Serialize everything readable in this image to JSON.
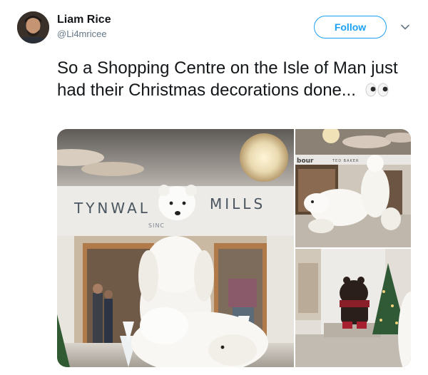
{
  "author": {
    "name": "Liam Rice",
    "handle": "@Li4mricee"
  },
  "actions": {
    "follow_label": "Follow"
  },
  "tweet": {
    "text": "So a Shopping Centre on the Isle of Man just had their Christmas decorations done...",
    "emoji": "eyes"
  },
  "media": {
    "main_photo": {
      "store_sign": "TYNWALD MILLS",
      "store_sign_visible_left": "TYNWAL",
      "store_sign_visible_right": "MILLS",
      "store_sign_sub": "SINC"
    },
    "top_photo": {
      "sign_left": "bour",
      "sign_right": "TED BAKER"
    }
  },
  "colors": {
    "accent": "#1da1f2",
    "text": "#14171a",
    "muted": "#657786"
  }
}
